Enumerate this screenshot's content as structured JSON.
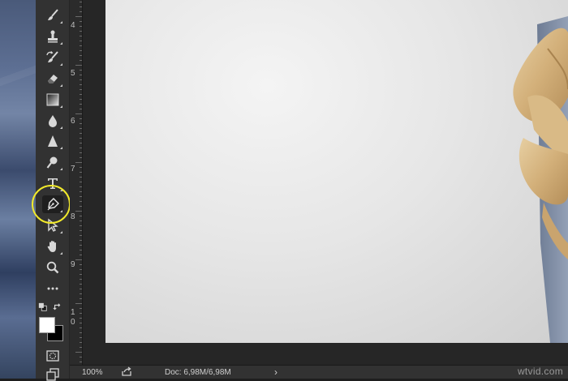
{
  "ruler": {
    "labels": [
      "4",
      "5",
      "6",
      "7",
      "8",
      "9",
      "1",
      "0"
    ]
  },
  "toolbar": {
    "tools": [
      {
        "id": "brush",
        "icon": "brush-icon"
      },
      {
        "id": "stamp",
        "icon": "clone-stamp-icon"
      },
      {
        "id": "history-brush",
        "icon": "history-brush-icon"
      },
      {
        "id": "eraser",
        "icon": "eraser-icon"
      },
      {
        "id": "gradient",
        "icon": "gradient-icon"
      },
      {
        "id": "blur",
        "icon": "blur-drop-icon"
      },
      {
        "id": "sharpen",
        "icon": "sharpen-triangle-icon"
      },
      {
        "id": "dodge",
        "icon": "dodge-icon"
      },
      {
        "id": "type",
        "icon": "type-icon"
      },
      {
        "id": "pen",
        "icon": "pen-icon",
        "active": true
      },
      {
        "id": "path-selection",
        "icon": "path-selection-icon"
      },
      {
        "id": "hand",
        "icon": "hand-icon"
      },
      {
        "id": "zoom",
        "icon": "zoom-icon"
      },
      {
        "id": "more",
        "icon": "more-dots-icon"
      }
    ],
    "foreground_color": "#ffffff",
    "background_color": "#000000",
    "highlight_color": "#f2ea2b"
  },
  "status": {
    "zoom": "100%",
    "doc": "Doc: 6,98M/6,98M",
    "arrow": "›"
  },
  "watermark": "wtvid.com"
}
